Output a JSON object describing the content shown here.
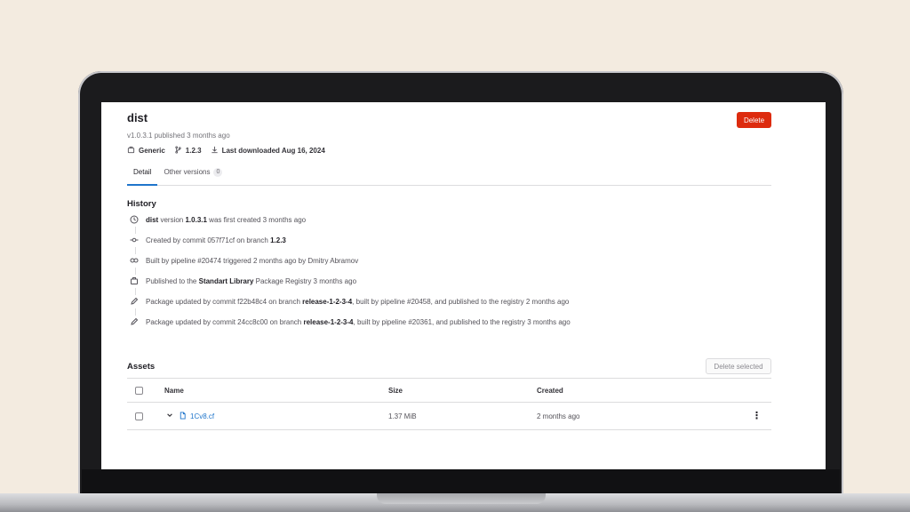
{
  "package": {
    "name": "dist",
    "subtitle": "v1.0.3.1 published 3 months ago",
    "delete_label": "Delete",
    "meta": [
      {
        "icon": "package-icon",
        "label": "Generic"
      },
      {
        "icon": "branch-icon",
        "label": "1.2.3"
      },
      {
        "icon": "download-icon",
        "label": "Last downloaded Aug 16, 2024"
      }
    ]
  },
  "tabs": [
    {
      "label": "Detail",
      "active": true
    },
    {
      "label": "Other versions",
      "count": "0",
      "active": false
    }
  ],
  "history": {
    "title": "History",
    "items": [
      {
        "icon": "clock-icon",
        "parts": [
          [
            "b",
            "dist"
          ],
          [
            "t",
            " version "
          ],
          [
            "b",
            "1.0.3.1"
          ],
          [
            "t",
            " was first created 3 months ago"
          ]
        ]
      },
      {
        "icon": "commit-icon",
        "parts": [
          [
            "t",
            "Created by commit 057f71cf on branch "
          ],
          [
            "b",
            "1.2.3"
          ]
        ]
      },
      {
        "icon": "pipeline-icon",
        "parts": [
          [
            "t",
            "Built by pipeline #20474 triggered 2 months ago by Dmitry Abramov"
          ]
        ]
      },
      {
        "icon": "package-icon",
        "parts": [
          [
            "t",
            "Published to the "
          ],
          [
            "b",
            "Standart Library"
          ],
          [
            "t",
            " Package Registry 3 months ago"
          ]
        ]
      },
      {
        "icon": "pencil-icon",
        "parts": [
          [
            "t",
            "Package updated by commit f22b48c4 on branch "
          ],
          [
            "b",
            "release-1-2-3-4"
          ],
          [
            "t",
            ", built by pipeline #20458, and published to the registry 2 months ago"
          ]
        ]
      },
      {
        "icon": "pencil-icon",
        "parts": [
          [
            "t",
            "Package updated by commit 24cc8c00 on branch "
          ],
          [
            "b",
            "release-1-2-3-4"
          ],
          [
            "t",
            ", built by pipeline #20361, and published to the registry 3 months ago"
          ]
        ]
      }
    ]
  },
  "assets": {
    "title": "Assets",
    "delete_selected_label": "Delete selected",
    "columns": {
      "name": "Name",
      "size": "Size",
      "created": "Created"
    },
    "rows": [
      {
        "name": "1Cv8.cf",
        "size": "1.37 MiB",
        "created": "2 months ago"
      }
    ]
  },
  "colors": {
    "accent": "#1f75cb",
    "danger": "#dd2b0e"
  }
}
